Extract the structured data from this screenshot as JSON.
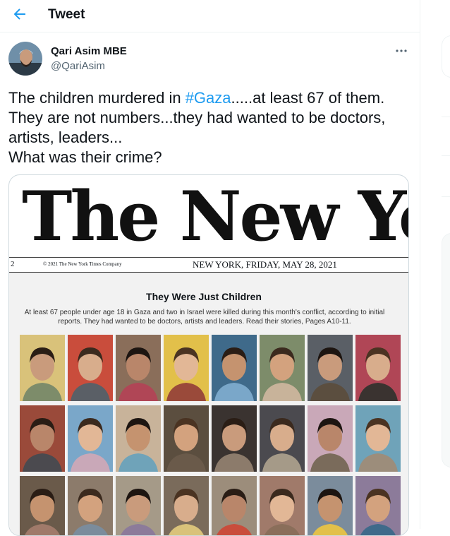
{
  "header": {
    "title": "Tweet"
  },
  "tweet": {
    "author_name": "Qari Asim MBE",
    "handle": "@QariAsim",
    "text_before_tag": "The children murdered in ",
    "hashtag": "#Gaza",
    "text_after_tag": ".....at least 67 of them.",
    "line2": "They are not numbers...they had wanted to be doctors, artists, leaders...",
    "line3": "What was their crime?"
  },
  "media": {
    "masthead": "The New York T",
    "page_number": "2",
    "copyright": "© 2021 The New York Times Company",
    "dateline": "NEW YORK, FRIDAY, MAY 28, 2021",
    "headline": "They Were Just Children",
    "subhead": "At least 67 people under age 18 in Gaza and two in Israel were killed during this month's conflict, according to initial reports. They had wanted to be doctors, artists and leaders. Read their stories, Pages A10-11."
  },
  "colors": {
    "accent": "#1d9bf0",
    "text": "#0f1419",
    "muted": "#536471",
    "border": "#eff3f4"
  },
  "icons": {
    "back": "arrow-left-icon",
    "more": "more-horizontal-icon"
  }
}
